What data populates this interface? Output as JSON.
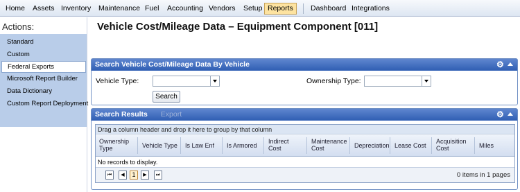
{
  "menu": {
    "items": [
      "Home",
      "Assets",
      "Inventory",
      "Maintenance",
      "Fuel",
      "Accounting",
      "Vendors",
      "Setup",
      "Reports",
      "Dashboard",
      "Integrations"
    ],
    "active": "Reports"
  },
  "sidebar": {
    "title": "Actions:",
    "items": [
      "Standard",
      "Custom",
      "Federal Exports",
      "Microsoft Report Builder",
      "Data Dictionary",
      "Custom Report Deployment"
    ],
    "selected": "Federal Exports"
  },
  "page": {
    "title": "Vehicle Cost/Mileage Data – Equipment Component [011]"
  },
  "search_panel": {
    "title": "Search Vehicle Cost/Mileage Data By Vehicle",
    "vehicle_type_label": "Vehicle Type:",
    "vehicle_type_value": "",
    "ownership_type_label": "Ownership Type:",
    "ownership_type_value": "",
    "search_button": "Search"
  },
  "results_panel": {
    "title": "Search Results",
    "export_label": "Export",
    "group_hint": "Drag a column header and drop it here to group by that column",
    "columns": [
      [
        "Ownership",
        "Type"
      ],
      [
        "Vehicle Type"
      ],
      [
        "Is Law Enf"
      ],
      [
        "Is Armored"
      ],
      [
        "Indirect",
        "Cost"
      ],
      [
        "Maintenance",
        "Cost"
      ],
      [
        "Depreciation"
      ],
      [
        "Lease Cost"
      ],
      [
        "Acquisition",
        "Cost"
      ],
      [
        "Miles"
      ]
    ],
    "empty_text": "No records to display.",
    "pager": {
      "first": "⏮",
      "prev": "◀",
      "page": "1",
      "next": "▶",
      "last": "⏭",
      "info": "0 items in 1 pages"
    }
  },
  "colors": {
    "panel_header": "#3a66b8",
    "sidebar_bg": "#b9cde9",
    "active_menu": "#fde3a0"
  }
}
